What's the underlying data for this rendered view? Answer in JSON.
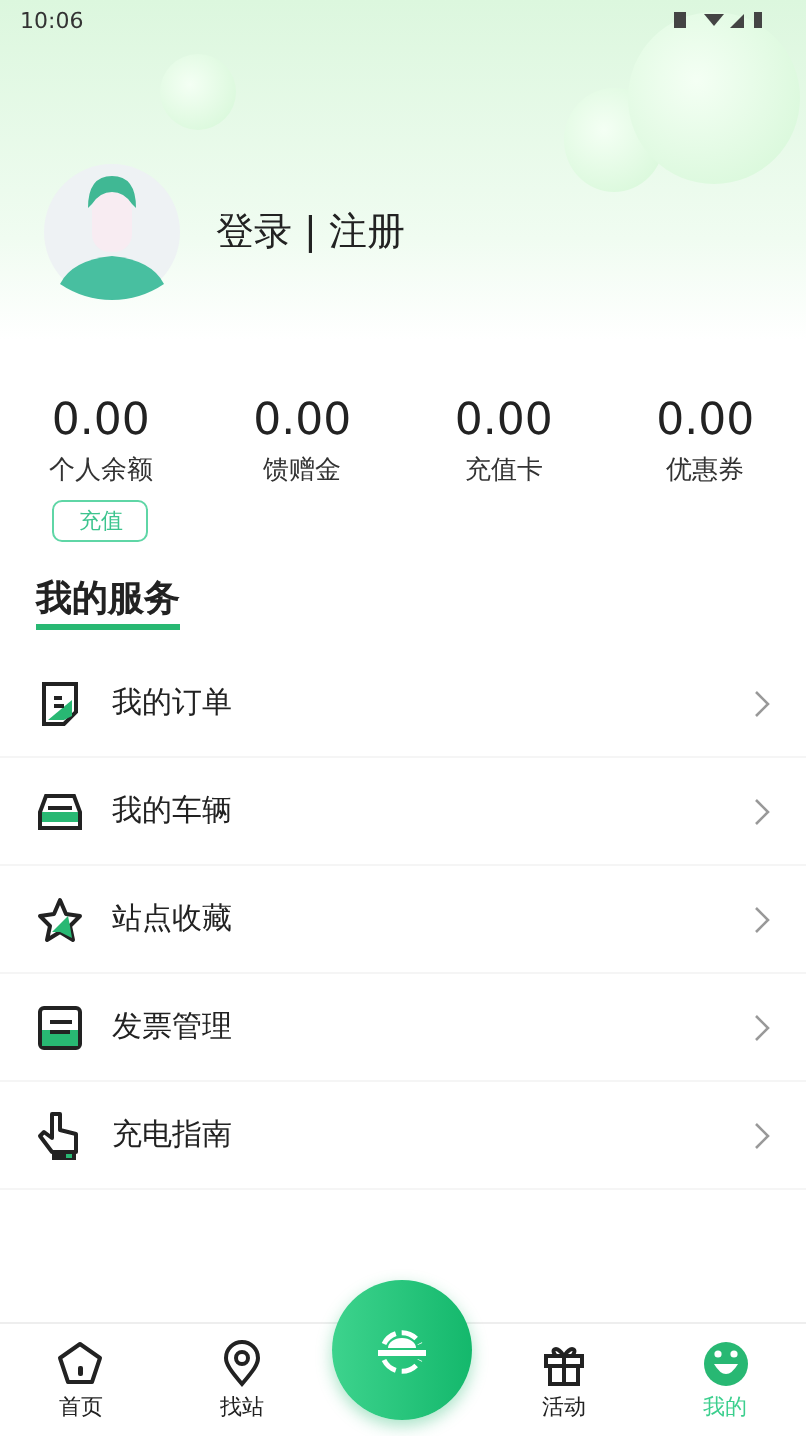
{
  "status_bar": {
    "time": "10:06"
  },
  "profile": {
    "login_text": "登录 | 注册"
  },
  "stats": [
    {
      "value": "0.00",
      "label": "个人余额"
    },
    {
      "value": "0.00",
      "label": "馈赠金"
    },
    {
      "value": "0.00",
      "label": "充值卡"
    },
    {
      "value": "0.00",
      "label": "优惠券"
    }
  ],
  "recharge_button": "充值",
  "services": {
    "title": "我的服务",
    "items": [
      {
        "kind": "order",
        "label": "我的订单"
      },
      {
        "kind": "car",
        "label": "我的车辆"
      },
      {
        "kind": "star",
        "label": "站点收藏"
      },
      {
        "kind": "invoice",
        "label": "发票管理"
      },
      {
        "kind": "guide",
        "label": "充电指南"
      }
    ]
  },
  "tabs": [
    {
      "kind": "home",
      "label": "首页",
      "selected": false
    },
    {
      "kind": "station",
      "label": "找站",
      "selected": false
    },
    {
      "kind": "scan"
    },
    {
      "kind": "gift",
      "label": "活动",
      "selected": false
    },
    {
      "kind": "me",
      "label": "我的",
      "selected": true
    }
  ]
}
